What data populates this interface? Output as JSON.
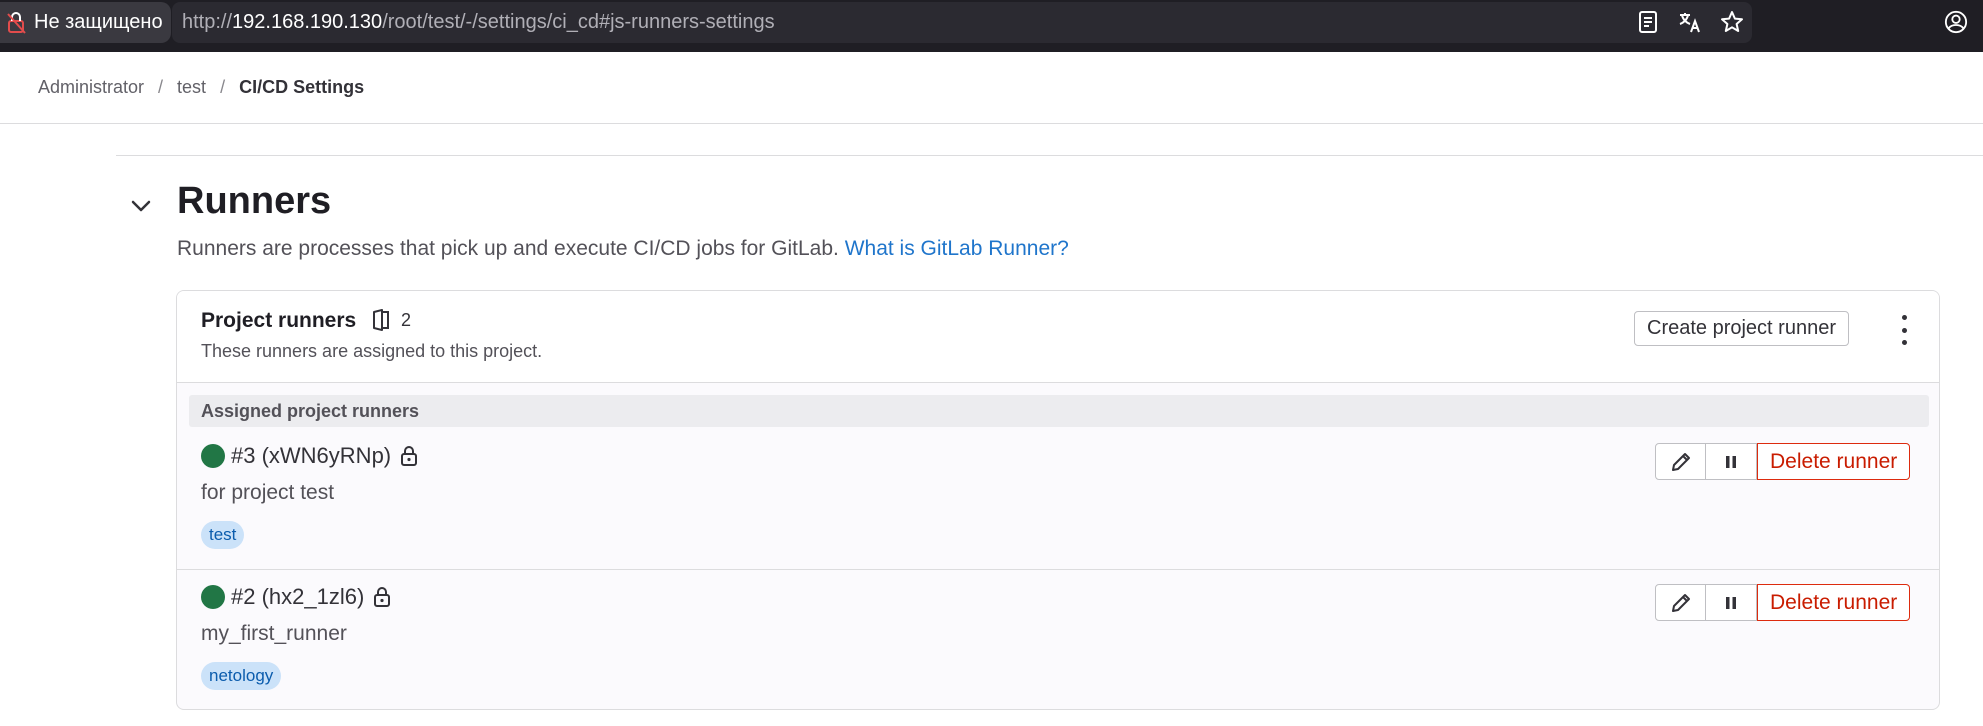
{
  "browser": {
    "security_label": "Не защищено",
    "url_prefix": "http://",
    "url_host": "192.168.190.130",
    "url_path": "/root/test/-/settings/ci_cd#js-runners-settings"
  },
  "breadcrumb": {
    "items": [
      "Administrator",
      "test",
      "CI/CD Settings"
    ]
  },
  "runners_section": {
    "title": "Runners",
    "description": "Runners are processes that pick up and execute CI/CD jobs for GitLab.",
    "help_link": "What is GitLab Runner?"
  },
  "project_runners": {
    "title": "Project runners",
    "count": "2",
    "subtitle": "These runners are assigned to this project.",
    "create_button": "Create project runner",
    "subheader": "Assigned project runners",
    "runners": [
      {
        "name": "#3 (xWN6yRNp)",
        "description": "for project test",
        "tag": "test",
        "delete_label": "Delete runner"
      },
      {
        "name": "#2 (hx2_1zl6)",
        "description": "my_first_runner",
        "tag": "netology",
        "delete_label": "Delete runner"
      }
    ]
  },
  "colors": {
    "online": "#217645",
    "link": "#1f75cb",
    "danger": "#dd2b0e"
  }
}
